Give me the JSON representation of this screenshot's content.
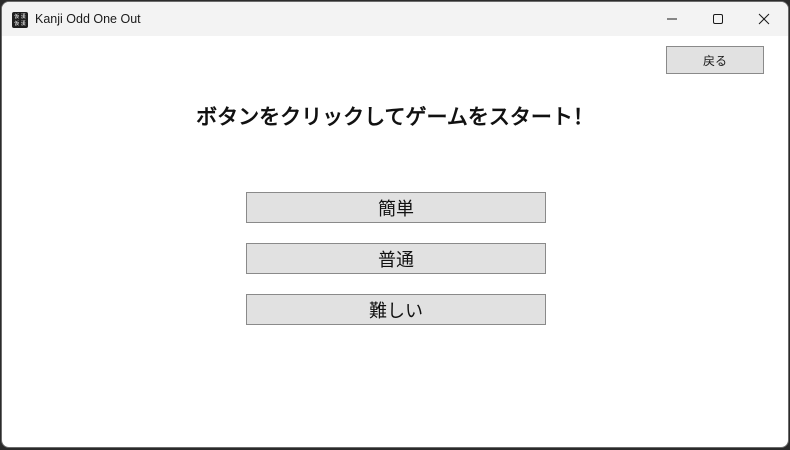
{
  "window": {
    "title": "Kanji Odd One Out",
    "icon_glyphs": [
      "仮",
      "漢",
      "仮",
      "漢"
    ]
  },
  "controls": {
    "minimize_icon": "minimize-icon",
    "maximize_icon": "maximize-icon",
    "close_icon": "close-icon"
  },
  "toolbar": {
    "back_label": "戻る"
  },
  "main": {
    "heading": "ボタンをクリックしてゲームをスタート！",
    "difficulties": [
      {
        "label": "簡単"
      },
      {
        "label": "普通"
      },
      {
        "label": "難しい"
      }
    ]
  },
  "colors": {
    "button_bg": "#e1e1e1",
    "button_border": "#8a8a8a",
    "titlebar_bg": "#f3f3f3"
  }
}
